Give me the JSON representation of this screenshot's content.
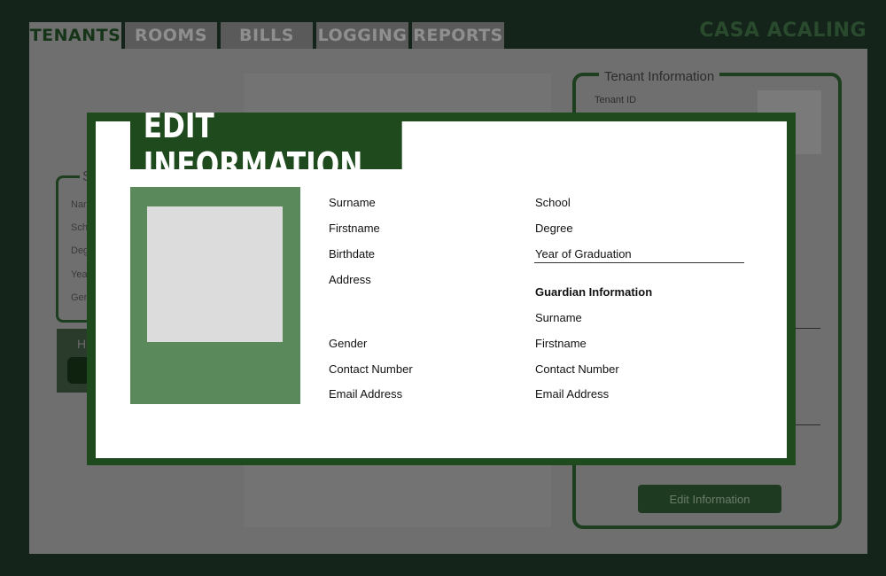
{
  "app": {
    "brand": "CASA ACALING",
    "tabs": [
      {
        "label": "TENANTS",
        "active": true
      },
      {
        "label": "ROOMS",
        "active": false
      },
      {
        "label": "BILLS",
        "active": false
      },
      {
        "label": "LOGGING",
        "active": false
      },
      {
        "label": "REPORTS",
        "active": false
      }
    ]
  },
  "background": {
    "left_box": {
      "label": "S",
      "rows": [
        "Nar",
        "Sch",
        "Deg",
        "Yea",
        "Gen"
      ]
    },
    "left_dark": {
      "label": "H"
    },
    "tenant_info": {
      "title": "Tenant Information",
      "tenant_id_label": "Tenant ID",
      "edit_button": "Edit Information"
    }
  },
  "modal": {
    "title": "EDIT INFORMATION",
    "left_fields": [
      "Surname",
      "Firstname",
      "Birthdate",
      "Address",
      "Gender",
      "Contact Number",
      "Email Address"
    ],
    "right_fields": [
      "School",
      "Degree",
      "Year of Graduation"
    ],
    "guardian_header": "Guardian Information",
    "guardian_fields": [
      "Surname",
      "Firstname",
      "Contact Number",
      "Email Address"
    ]
  },
  "colors": {
    "dark_green": "#1e4a1e",
    "photo_frame": "#5a8a5c",
    "page_bg": "#14241a"
  }
}
